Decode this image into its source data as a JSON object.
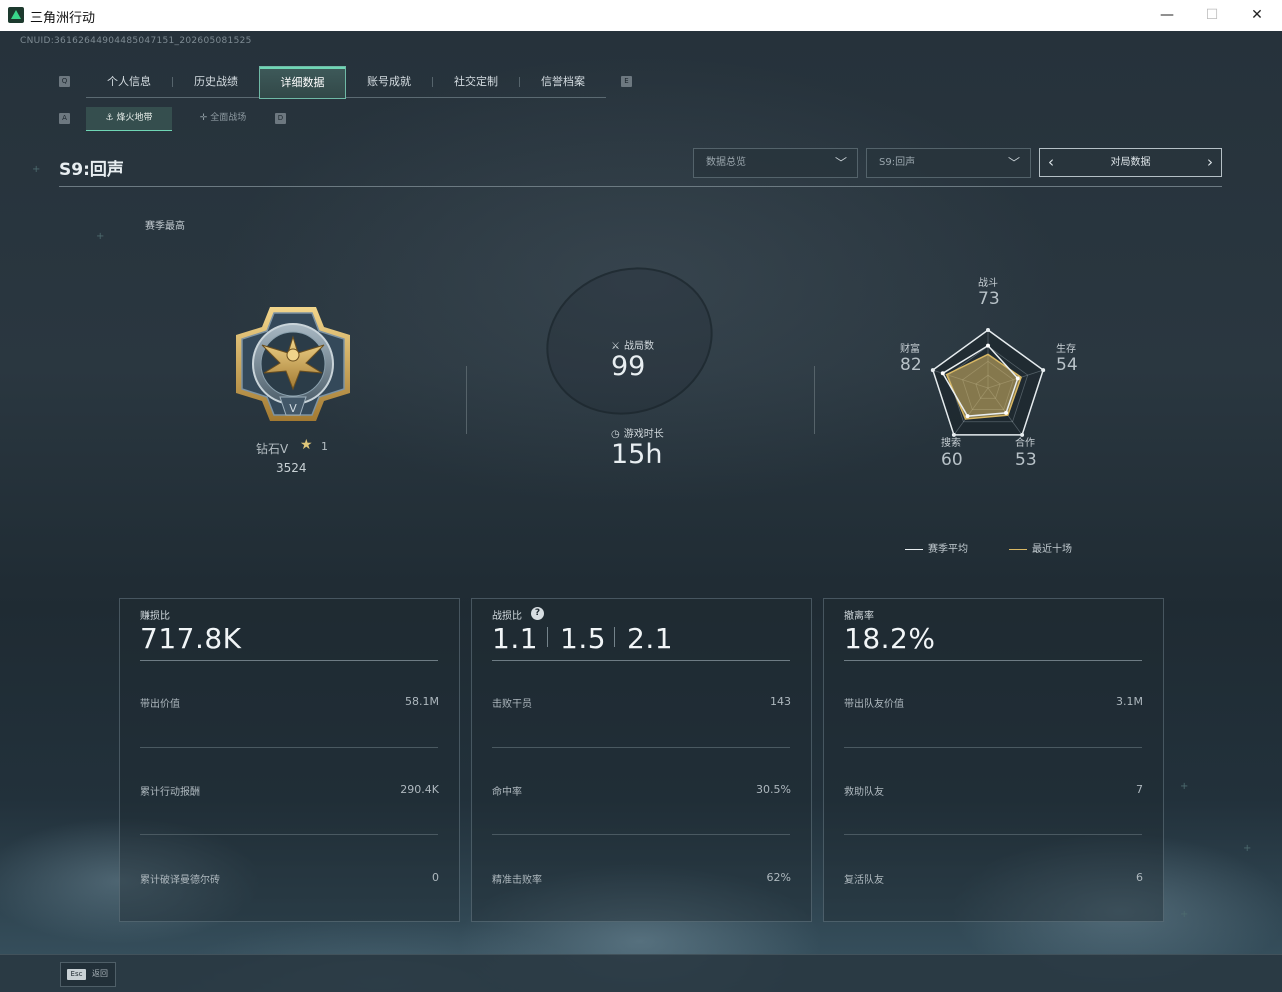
{
  "window": {
    "title": "三角洲行动",
    "minimize": "—",
    "maximize": "☐",
    "close": "✕"
  },
  "header": {
    "uid": "CNUID:36162644904485047151_202605081525"
  },
  "main_tabs": {
    "left_key": "Q",
    "right_key": "E",
    "items": [
      {
        "label": "个人信息"
      },
      {
        "label": "历史战绩"
      },
      {
        "label": "详细数据"
      },
      {
        "label": "账号成就"
      },
      {
        "label": "社交定制"
      },
      {
        "label": "信誉档案"
      }
    ],
    "active_index": 2
  },
  "sub_tabs": {
    "left_key": "A",
    "right_key": "D",
    "items": [
      {
        "label": "烽火地带"
      },
      {
        "label": "全面战场"
      }
    ],
    "active_index": 0
  },
  "season": {
    "title": "S9:回声",
    "peak_label": "赛季最高"
  },
  "filters": {
    "mode_select": "数据总览",
    "season_select": "S9:回声",
    "pager_label": "对局数据",
    "prev": "‹",
    "next": "›"
  },
  "rank": {
    "name": "钻石V",
    "stars": "1",
    "score": "3524",
    "medal_numeral": "V"
  },
  "summary": {
    "matches_label": "战局数",
    "matches_value": "99",
    "playtime_label": "游戏时长",
    "playtime_value": "15h"
  },
  "radar": {
    "axes": [
      {
        "label": "战斗",
        "value": "73"
      },
      {
        "label": "生存",
        "value": "54"
      },
      {
        "label": "合作",
        "value": "53"
      },
      {
        "label": "搜索",
        "value": "60"
      },
      {
        "label": "财富",
        "value": "82"
      }
    ],
    "legend": [
      {
        "label": "赛季平均",
        "color": "#e9eef0"
      },
      {
        "label": "最近十场",
        "color": "#d9b864"
      }
    ],
    "season_avg": [
      73,
      54,
      53,
      60,
      82
    ],
    "recent_ten": [
      58,
      60,
      58,
      66,
      75
    ]
  },
  "cards": [
    {
      "head_label": "赚损比",
      "head_value": "717.8K",
      "rows": [
        {
          "label": "带出价值",
          "value": "58.1M"
        },
        {
          "label": "累计行动报酬",
          "value": "290.4K"
        },
        {
          "label": "累计破译曼德尔砖",
          "value": "0"
        }
      ]
    },
    {
      "head_label": "战损比",
      "help": "?",
      "head_values": [
        "1.1",
        "1.5",
        "2.1"
      ],
      "rows": [
        {
          "label": "击败干员",
          "value": "143"
        },
        {
          "label": "命中率",
          "value": "30.5%"
        },
        {
          "label": "精准击败率",
          "value": "62%"
        }
      ]
    },
    {
      "head_label": "撤离率",
      "head_value": "18.2%",
      "rows": [
        {
          "label": "带出队友价值",
          "value": "3.1M"
        },
        {
          "label": "救助队友",
          "value": "7"
        },
        {
          "label": "复活队友",
          "value": "6"
        }
      ]
    }
  ],
  "footer": {
    "esc_key": "Esc",
    "back_label": "返回"
  }
}
